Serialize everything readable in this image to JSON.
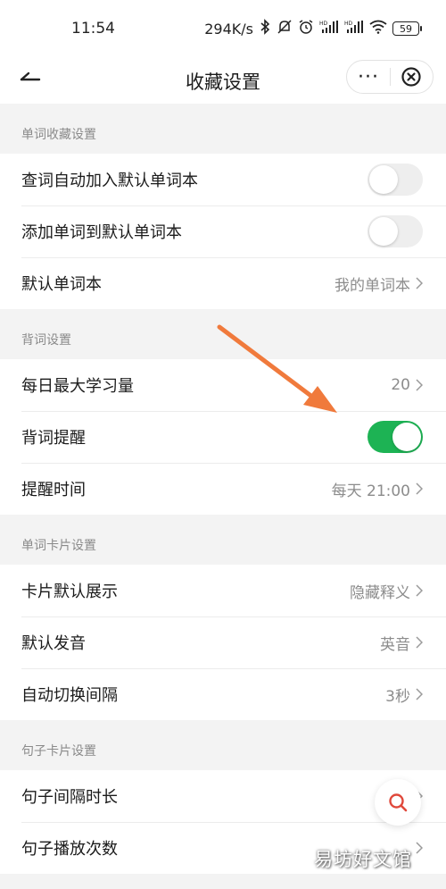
{
  "status_bar": {
    "time": "11:54",
    "speed": "294K/s",
    "battery": "59",
    "icons": [
      "bluetooth-icon",
      "mute-icon",
      "alarm-icon",
      "signal-hd-1-icon",
      "signal-hd-2-icon",
      "wifi-icon",
      "battery-icon"
    ]
  },
  "nav": {
    "title": "收藏设置",
    "back_icon": "back-arrow-icon",
    "more_label": "···",
    "close_icon": "close-circle-icon"
  },
  "sections": [
    {
      "header": "单词收藏设置",
      "rows": [
        {
          "label": "查词自动加入默认单词本",
          "type": "toggle",
          "on": false
        },
        {
          "label": "添加单词到默认单词本",
          "type": "toggle",
          "on": false
        },
        {
          "label": "默认单词本",
          "type": "value",
          "value": "我的单词本"
        }
      ]
    },
    {
      "header": "背词设置",
      "rows": [
        {
          "label": "每日最大学习量",
          "type": "value",
          "value": "20"
        },
        {
          "label": "背词提醒",
          "type": "toggle",
          "on": true
        },
        {
          "label": "提醒时间",
          "type": "value",
          "value": "每天 21:00"
        }
      ]
    },
    {
      "header": "单词卡片设置",
      "rows": [
        {
          "label": "卡片默认展示",
          "type": "value",
          "value": "隐藏释义"
        },
        {
          "label": "默认发音",
          "type": "value",
          "value": "英音"
        },
        {
          "label": "自动切换间隔",
          "type": "value",
          "value": "3秒"
        }
      ]
    },
    {
      "header": "句子卡片设置",
      "rows": [
        {
          "label": "句子间隔时长",
          "type": "value",
          "value": ""
        },
        {
          "label": "句子播放次数",
          "type": "value",
          "value": ""
        }
      ]
    }
  ],
  "watermark": "易坊好文馆",
  "colors": {
    "toggle_on": "#1db354",
    "toggle_off": "#eeeeee",
    "annotation_arrow": "#f07a3c",
    "search_icon": "#e0483b"
  }
}
